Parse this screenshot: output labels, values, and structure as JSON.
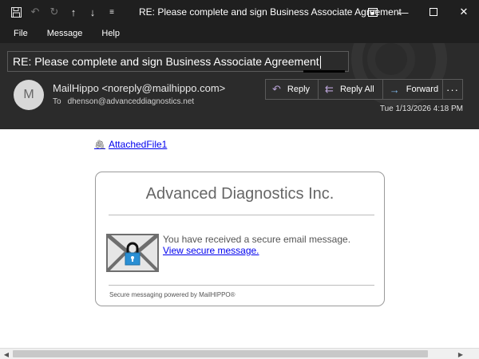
{
  "titlebar": {
    "title": "RE: Please complete and sign Business Associate Agreement",
    "icons": [
      "save-icon",
      "undo-icon",
      "redo-icon",
      "up-arrow-icon",
      "down-arrow-icon",
      "customize-icon"
    ],
    "controls": [
      "restore-icon",
      "minimize-icon",
      "maximize-icon",
      "close-icon"
    ]
  },
  "menu": {
    "items": [
      "File",
      "Message",
      "Help"
    ]
  },
  "header": {
    "subject": "RE: Please complete and sign Business Associate Agreement",
    "avatar_initial": "M",
    "sender": "MailHippo <noreply@mailhippo.com>",
    "to_label": "To",
    "to_address": "dhenson@advanceddiagnostics.net",
    "date": "Tue 1/13/2026 4:18 PM",
    "actions": {
      "reply": "Reply",
      "reply_all": "Reply All",
      "forward": "Forward",
      "more": "···"
    }
  },
  "body": {
    "attachment": "AttachedFile1",
    "card": {
      "title": "Advanced Diagnostics Inc.",
      "message": "You have received a secure email message.",
      "link": "View secure message.",
      "footer": "Secure messaging powered by MailHIPPO®"
    }
  },
  "colors": {
    "titlebar_bg": "#1f1f1f",
    "header_bg": "#2b2b2b",
    "link": "#0000ee",
    "lock_blue": "#2a8fd4",
    "envelope_gray": "#707070"
  }
}
